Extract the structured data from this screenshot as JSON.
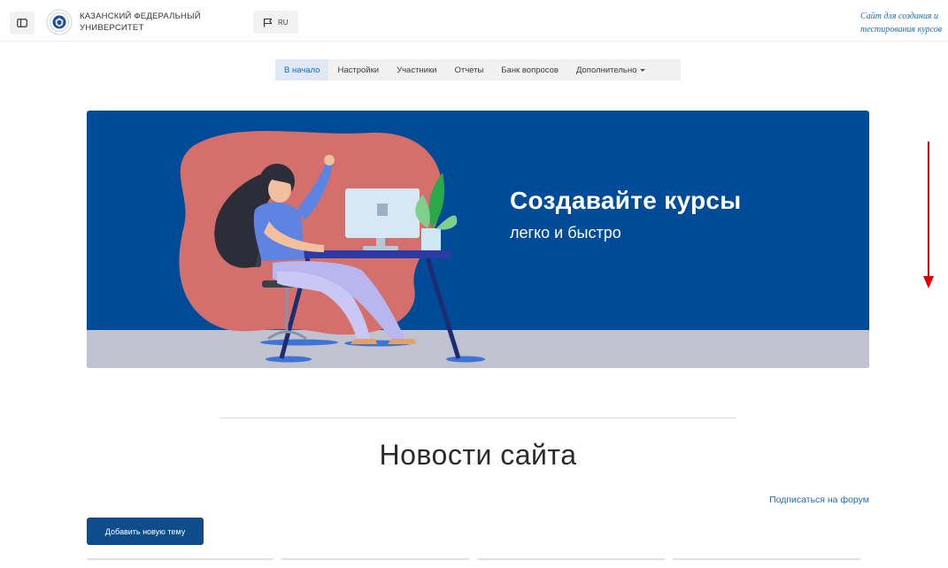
{
  "header": {
    "university_name_line1": "КАЗАНСКИЙ ФЕДЕРАЛЬНЫЙ",
    "university_name_line2": "УНИВЕРСИТЕТ",
    "language": "RU",
    "tagline_line1": "Сайт для создания и",
    "tagline_line2": "тестирования курсов"
  },
  "course_nav": {
    "items": [
      {
        "label": "В начало",
        "active": true
      },
      {
        "label": "Настройки"
      },
      {
        "label": "Участники"
      },
      {
        "label": "Отчеты"
      },
      {
        "label": "Банк вопросов"
      },
      {
        "label": "Дополнительно"
      }
    ]
  },
  "banner": {
    "title": "Создавайте курсы",
    "subtitle": "легко и быстро"
  },
  "news": {
    "title": "Новости сайта",
    "subscribe_label": "Подписаться на форум",
    "add_topic_label": "Добавить новую тему"
  },
  "colors": {
    "brand_blue": "#004b97",
    "link_blue": "#1f6bb8",
    "button_blue": "#0f4c8c",
    "annotation_red": "#e00000"
  },
  "icons": [
    "drawer-toggle-icon",
    "university-logo",
    "flag-icon",
    "caret-down-icon",
    "red-arrow-annotation"
  ]
}
